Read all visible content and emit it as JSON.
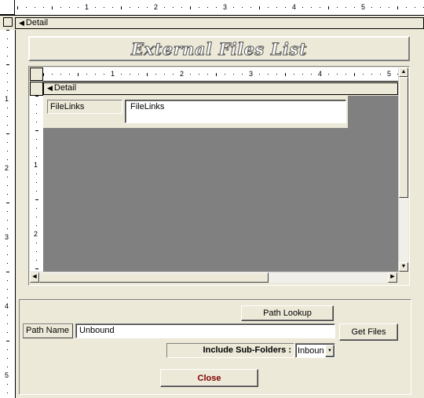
{
  "outer": {
    "ruler_numbers": [
      "1",
      "2",
      "3",
      "4",
      "5"
    ],
    "vruler_numbers": [
      "1",
      "2",
      "3",
      "4",
      "5"
    ],
    "section_label": "Detail"
  },
  "form": {
    "title": "External Files List",
    "subform": {
      "ruler_numbers": [
        "1",
        "2",
        "3",
        "4",
        "5"
      ],
      "vruler_numbers": [
        "1",
        "2"
      ],
      "section_label": "Detail",
      "field_label": "FileLinks",
      "field_value": "FileLinks"
    },
    "path_lookup_label": "Path Lookup",
    "path_name_label": "Path Name :",
    "path_name_value": "Unbound",
    "get_files_label": "Get Files",
    "include_subfolders_label": "Include Sub-Folders :",
    "include_subfolders_value": "Inbound",
    "close_label": "Close"
  },
  "colors": {
    "background": "#ece9d8",
    "title_outline": "#555555",
    "close_text": "#800000",
    "subform_background": "#808080"
  }
}
